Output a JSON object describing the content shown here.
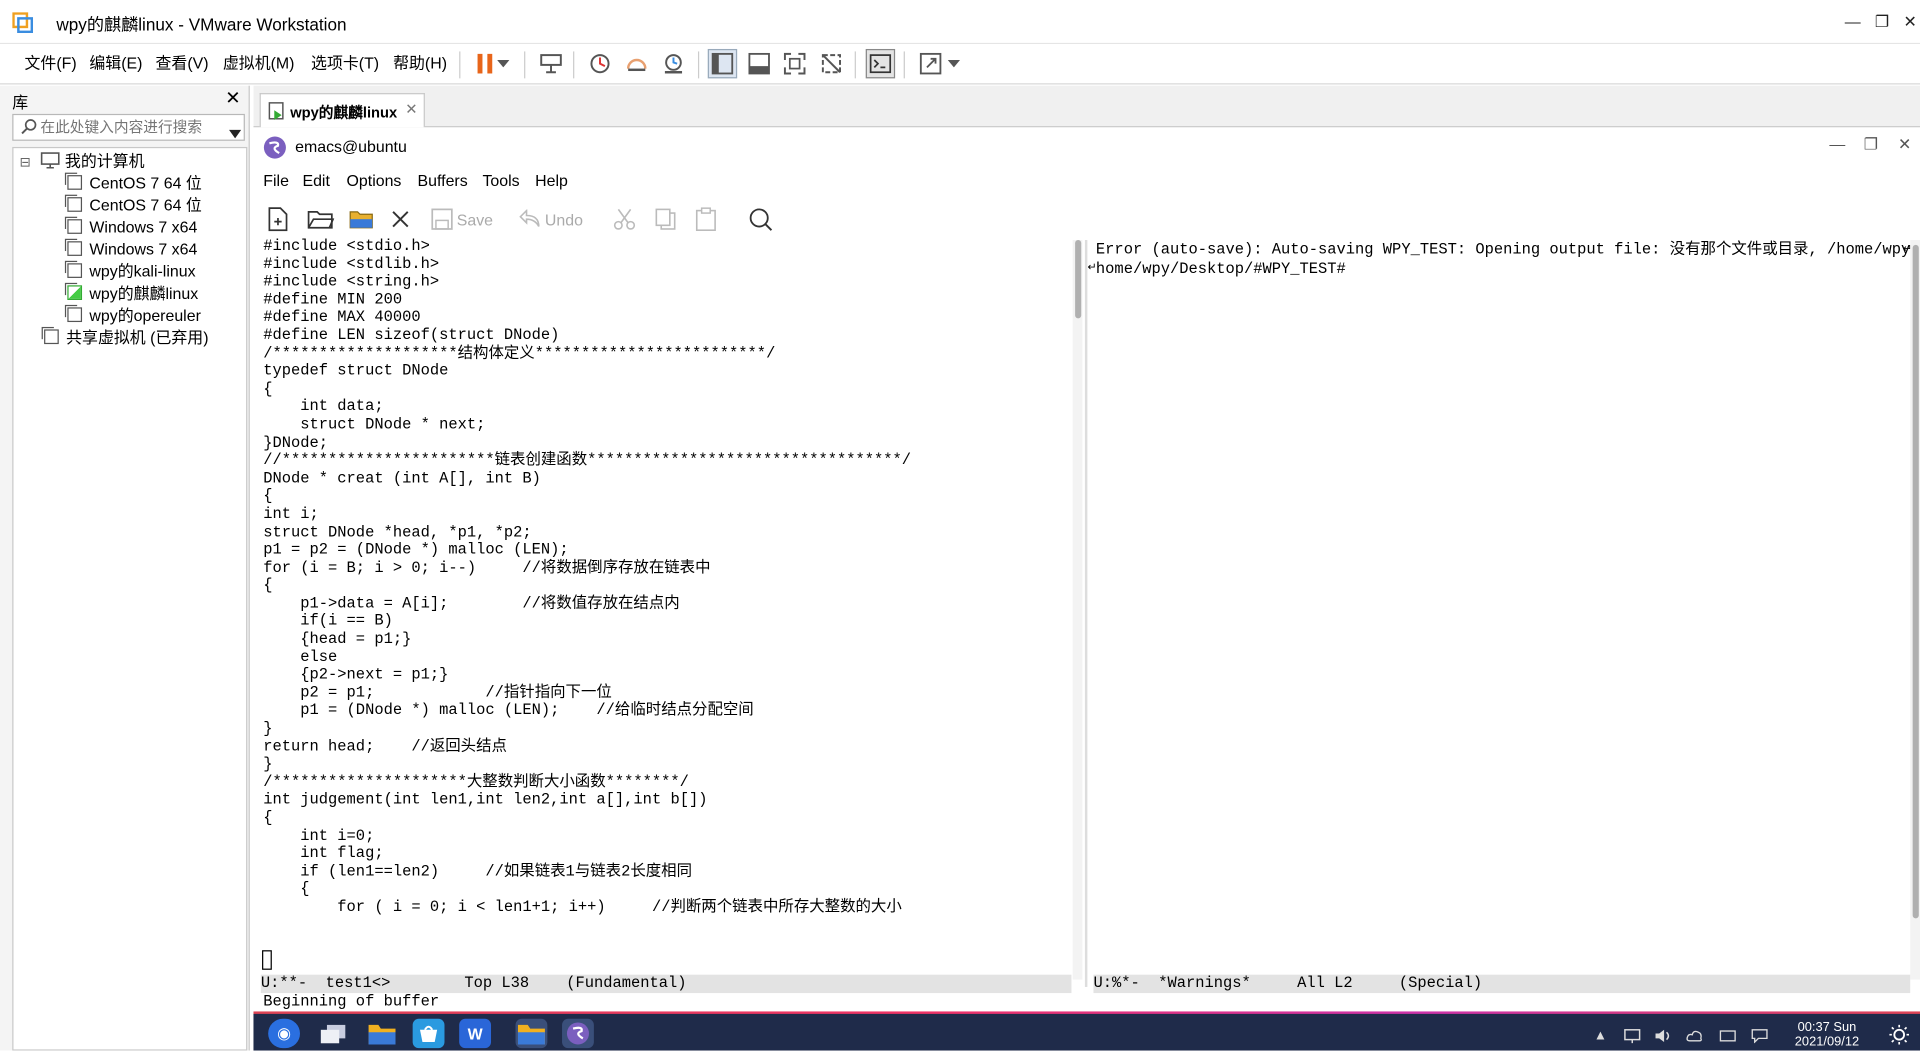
{
  "window": {
    "title": "wpy的麒麟linux - VMware Workstation",
    "minimize_glyph": "—",
    "restore_glyph": "❐",
    "close_glyph": "✕"
  },
  "menu": [
    "文件(F)",
    "编辑(E)",
    "查看(V)",
    "虚拟机(M)",
    "选项卡(T)",
    "帮助(H)"
  ],
  "library": {
    "title": "库",
    "close_glyph": "✕",
    "search_placeholder": "在此处键入内容进行搜索",
    "root_label": "我的计算机",
    "root_toggle": "⊟",
    "vms": [
      "CentOS 7 64 位",
      "CentOS 7 64 位",
      "Windows 7 x64",
      "Windows 7 x64",
      "wpy的kali-linux",
      "wpy的麒麟linux",
      "wpy的opereuler"
    ],
    "shared_label": "共享虚拟机 (已弃用)"
  },
  "tab": {
    "label": "wpy的麒麟linux",
    "close_glyph": "✕"
  },
  "emacs": {
    "title": "emacs@ubuntu",
    "menus": [
      "File",
      "Edit",
      "Options",
      "Buffers",
      "Tools",
      "Help"
    ],
    "toolbar": {
      "save_label": "Save",
      "undo_label": "Undo"
    },
    "code_lines": [
      "#include <stdio.h>",
      "#include <stdlib.h>",
      "#include <string.h>",
      "#define MIN 200",
      "#define MAX 40000",
      "#define LEN sizeof(struct DNode)",
      "/********************结构体定义*************************/",
      "typedef struct DNode",
      "{",
      "    int data;",
      "    struct DNode * next;",
      "}DNode;",
      "//***********************链表创建函数**********************************/",
      "DNode * creat (int A[], int B)",
      "{",
      "int i;",
      "struct DNode *head, *p1, *p2;",
      "p1 = p2 = (DNode *) malloc (LEN);",
      "for (i = B; i > 0; i--)     //将数据倒序存放在链表中",
      "{",
      "    p1->data = A[i];        //将数值存放在结点内",
      "    if(i == B)",
      "    {head = p1;}",
      "    else",
      "    {p2->next = p1;}",
      "    p2 = p1;            //指针指向下一位",
      "    p1 = (DNode *) malloc (LEN);    //给临时结点分配空间",
      "}",
      "return head;    //返回头结点",
      "}",
      "/*********************大整数判断大小函数********/",
      "int judgement(int len1,int len2,int a[],int b[])",
      "{",
      "    int i=0;",
      "    int flag;",
      "    if (len1==len2)     //如果链表1与链表2长度相同",
      "    {",
      "        for ( i = 0; i < len1+1; i++)     //判断两个链表中所存大整数的大小"
    ],
    "warnings_lines": [
      "Error (auto-save): Auto-saving WPY_TEST: Opening output file: 没有那个文件或目录, /home/wpy/",
      "home/wpy/Desktop/#WPY_TEST#"
    ],
    "modeline_left": "U:**-  test1<>        Top L38    (Fundamental)",
    "modeline_right": "U:%*-  *Warnings*     All L2     (Special)",
    "echo": "Beginning of buffer"
  },
  "taskbar": {
    "time": "00:37 Sun",
    "date": "2021/09/12"
  },
  "colors": {
    "taskbar_bg": "#1f2b4a",
    "emacs_logo": "#7b5fbf",
    "pause_icon": "#e8651a"
  }
}
